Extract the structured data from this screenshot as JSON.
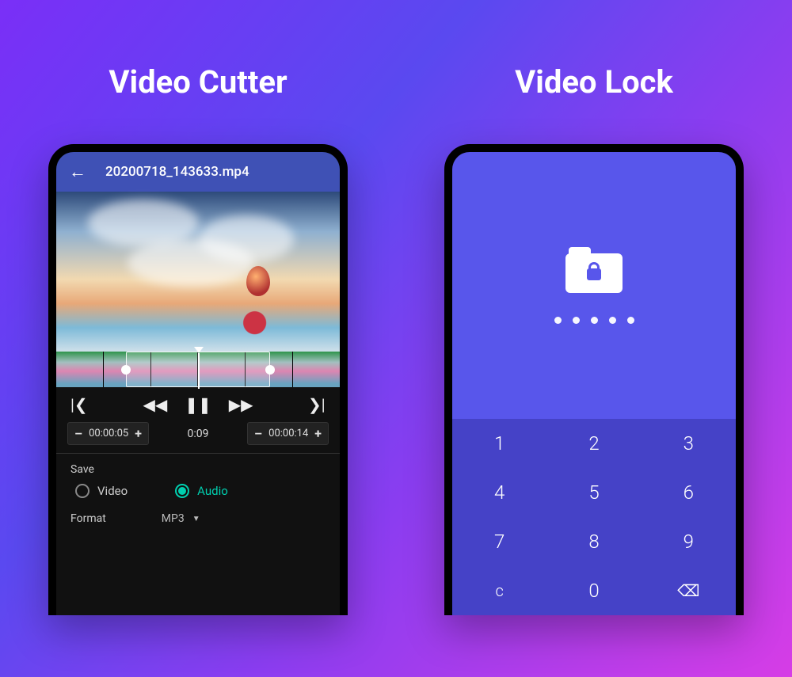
{
  "left": {
    "headline": "Video Cutter",
    "filename": "20200718_143633.mp4",
    "trim": {
      "start": "00:00:05",
      "end": "00:00:14",
      "current": "0:09"
    },
    "save": {
      "label": "Save",
      "options": {
        "video": "Video",
        "audio": "Audio"
      },
      "selected": "audio",
      "formatLabel": "Format",
      "formatValue": "MP3"
    },
    "icons": {
      "prevClip": "❯|",
      "rewind": "◀◀",
      "pause": "❚❚",
      "forward": "▶▶",
      "nextClip": "|❮",
      "minus": "–",
      "plus": "+",
      "back": "←",
      "caret": "▼"
    }
  },
  "right": {
    "headline": "Video Lock",
    "pinLength": 5,
    "keypad": [
      "1",
      "2",
      "3",
      "4",
      "5",
      "6",
      "7",
      "8",
      "9",
      "c",
      "0",
      "⌫"
    ]
  }
}
